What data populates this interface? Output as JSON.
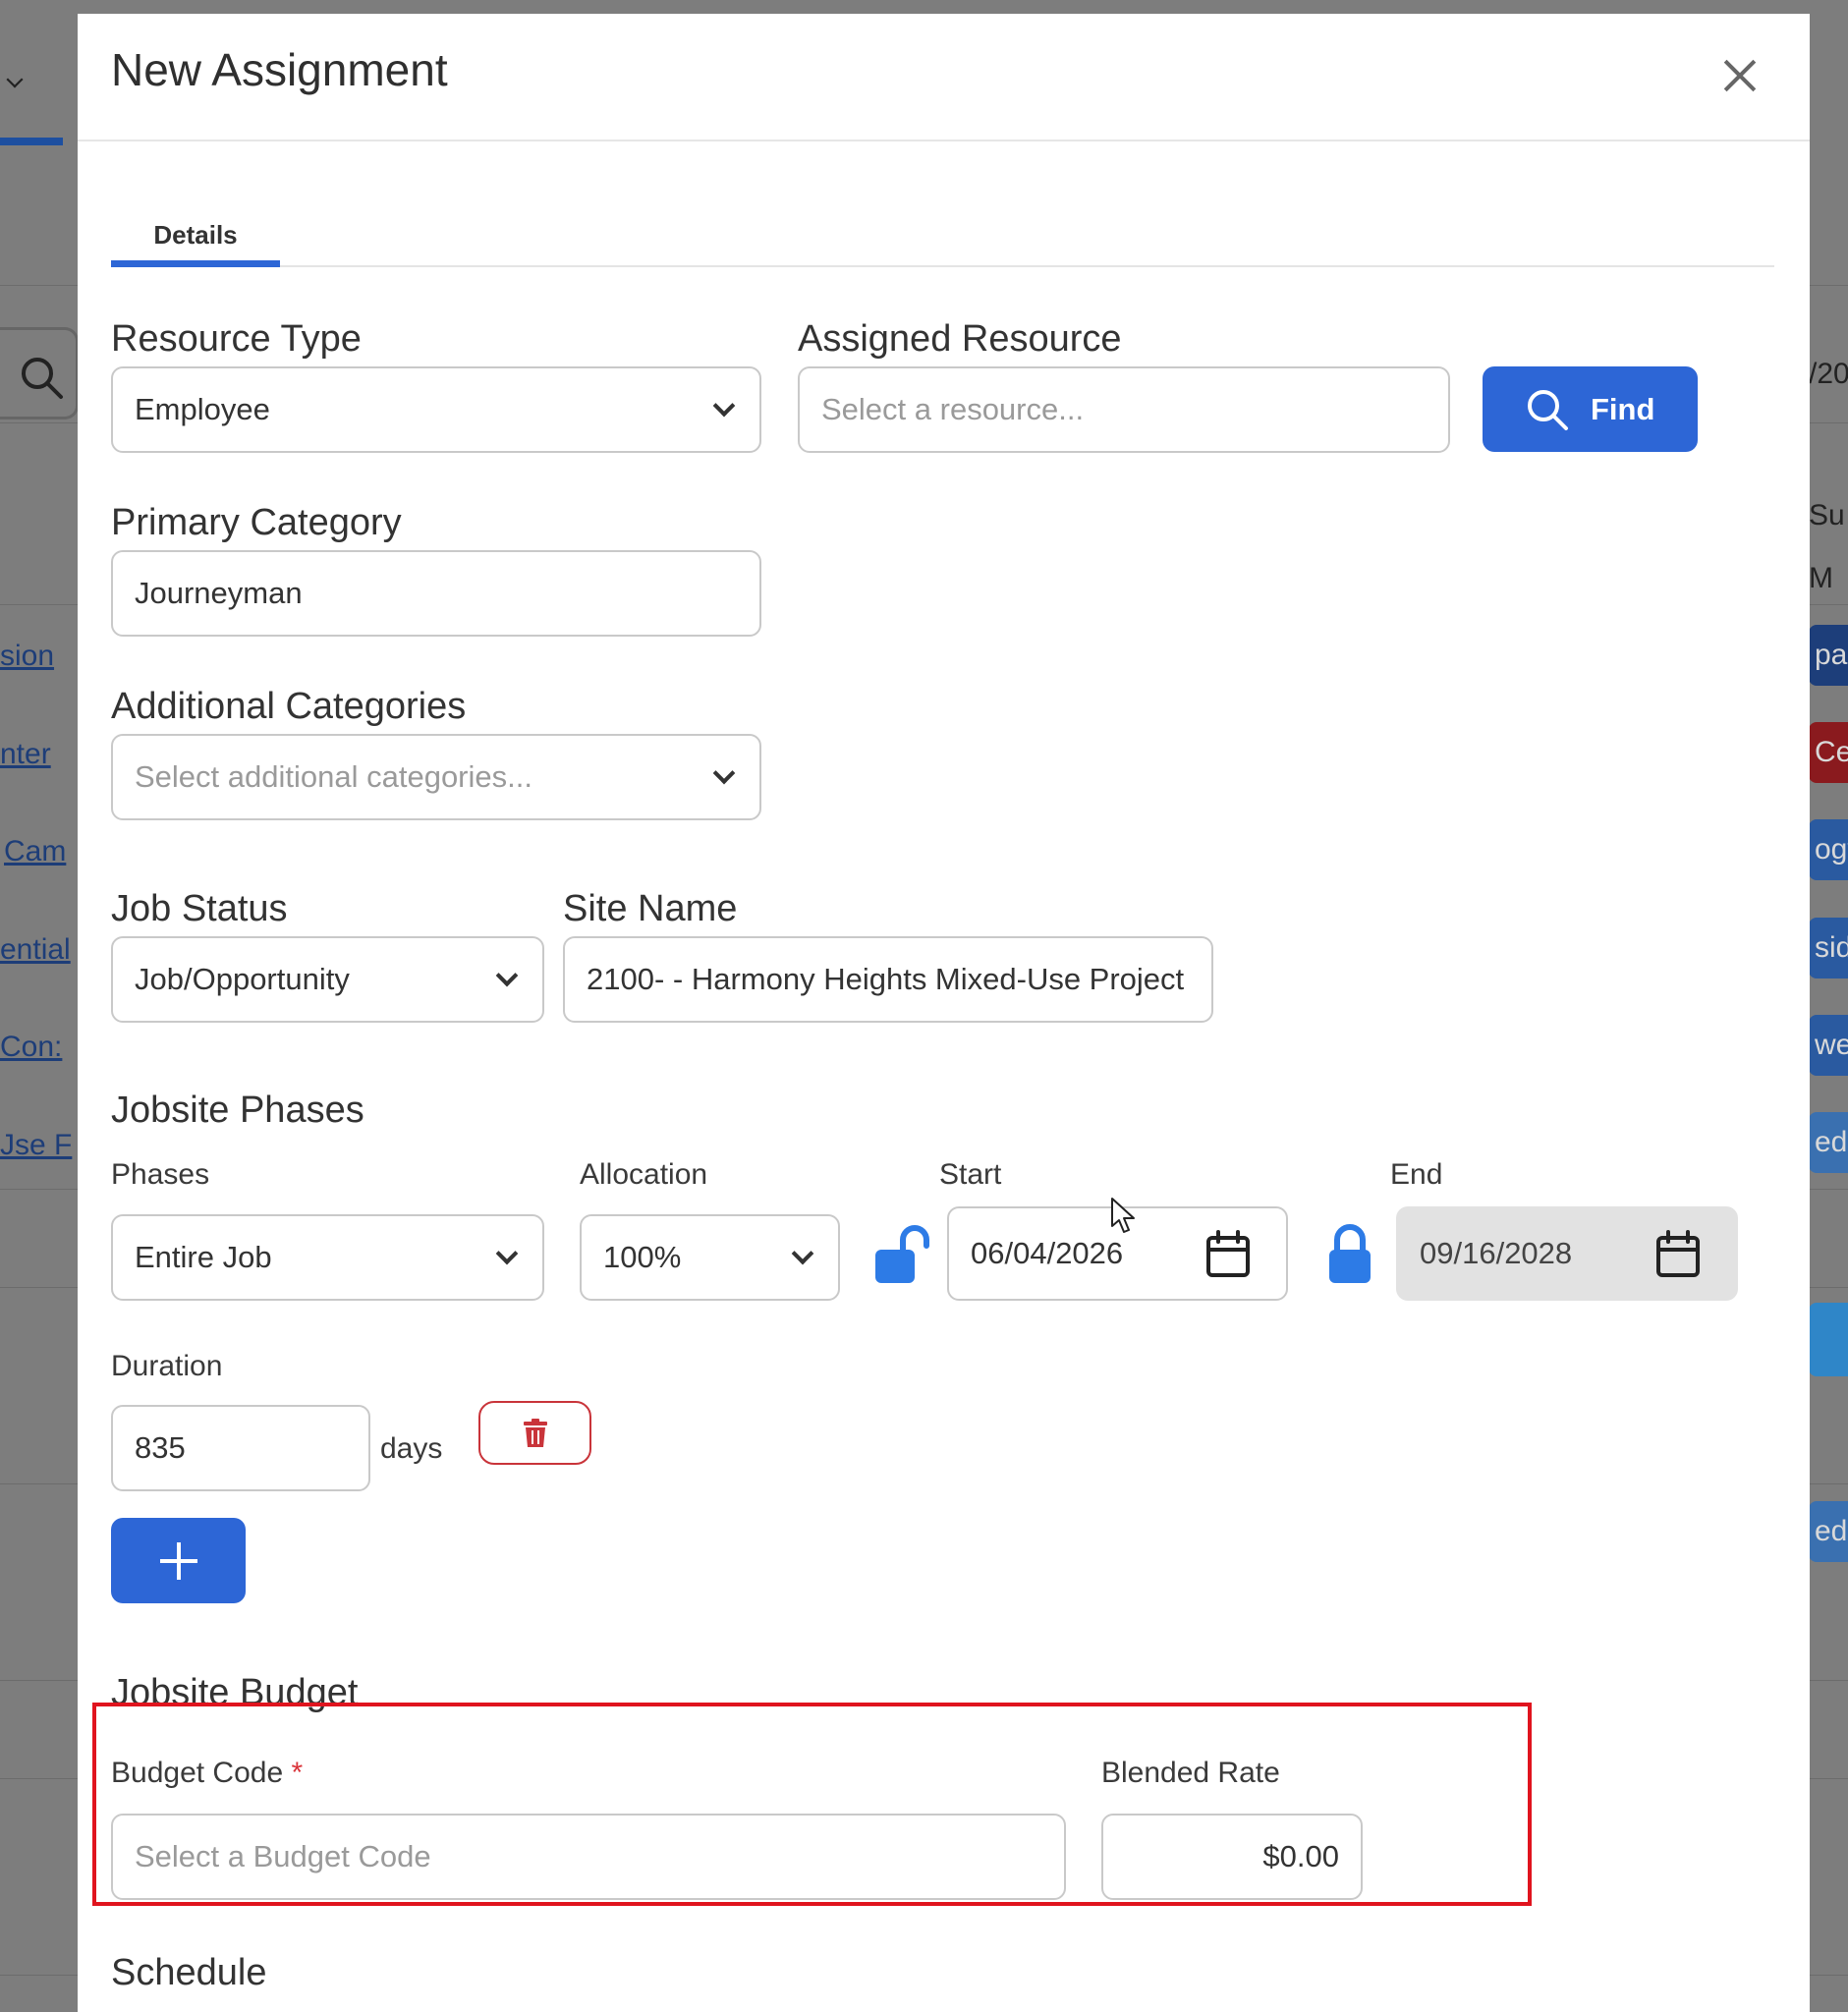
{
  "background": {
    "left_links": [
      "sion",
      "nter",
      "Cam",
      "ential",
      "Con:",
      "Jse F"
    ],
    "right_texts": [
      "/20",
      "Su",
      "M"
    ],
    "right_chips": [
      {
        "text": "par",
        "color": "#1d3e7a"
      },
      {
        "text": "Ce",
        "color": "#8a1a1e"
      },
      {
        "text": "ogy",
        "color": "#2a5aa0"
      },
      {
        "text": "sid",
        "color": "#2a5aa0"
      },
      {
        "text": "wer",
        "color": "#2a5aa0"
      },
      {
        "text": "ed-",
        "color": "#3a70b0"
      },
      {
        "text": "",
        "color": "#2f86c8"
      },
      {
        "text": "ed-",
        "color": "#3a70b0"
      }
    ]
  },
  "modal": {
    "title": "New Assignment",
    "tabs": [
      {
        "label": "Details",
        "active": true
      }
    ]
  },
  "form": {
    "resource_type": {
      "label": "Resource Type",
      "value": "Employee"
    },
    "assigned_resource": {
      "label": "Assigned Resource",
      "placeholder": "Select a resource..."
    },
    "find_button": "Find",
    "primary_category": {
      "label": "Primary Category",
      "value": "Journeyman"
    },
    "additional_categories": {
      "label": "Additional Categories",
      "placeholder": "Select additional categories..."
    },
    "job_status": {
      "label": "Job Status",
      "value": "Job/Opportunity"
    },
    "site_name": {
      "label": "Site Name",
      "value": "2100- - Harmony Heights Mixed-Use Project"
    },
    "jobsite_phases": {
      "heading": "Jobsite Phases",
      "phases_label": "Phases",
      "phases_value": "Entire Job",
      "allocation_label": "Allocation",
      "allocation_value": "100%",
      "start_label": "Start",
      "start_value": "06/04/2026",
      "start_locked": false,
      "end_label": "End",
      "end_value": "09/16/2028",
      "end_locked": true,
      "duration_label": "Duration",
      "duration_value": "835",
      "duration_unit": "days"
    },
    "jobsite_budget": {
      "heading": "Jobsite Budget",
      "budget_code_label": "Budget Code",
      "required_mark": "*",
      "budget_code_placeholder": "Select a Budget Code",
      "blended_rate_label": "Blended Rate",
      "blended_rate_value": "$0.00"
    },
    "schedule_heading": "Schedule"
  },
  "colors": {
    "primary": "#2d66d6",
    "danger": "#c9343a",
    "highlight": "#e0141e",
    "lock": "#2d7be6"
  }
}
